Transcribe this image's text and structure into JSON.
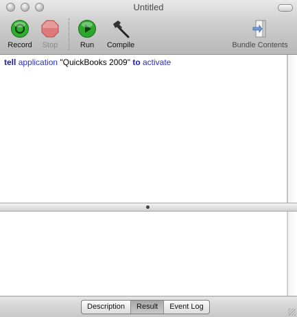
{
  "window": {
    "title": "Untitled"
  },
  "toolbar": {
    "record_label": "Record",
    "stop_label": "Stop",
    "run_label": "Run",
    "compile_label": "Compile",
    "bundle_contents_label": "Bundle Contents",
    "colors": {
      "record_green": "#2fae2f",
      "stop_red": "#e07a7a",
      "run_green": "#2ba82b"
    },
    "icons": {
      "record": "record-circle-icon",
      "stop": "stop-octagon-icon",
      "run": "play-icon",
      "compile": "hammer-icon",
      "bundle": "bundle-drawer-icon"
    }
  },
  "editor": {
    "tokens": [
      {
        "text": "tell",
        "type": "keyword"
      },
      {
        "text": " ",
        "type": "space"
      },
      {
        "text": "application",
        "type": "identifier"
      },
      {
        "text": " ",
        "type": "space"
      },
      {
        "text": "\"QuickBooks 2009\"",
        "type": "string"
      },
      {
        "text": " ",
        "type": "space"
      },
      {
        "text": "to",
        "type": "keyword"
      },
      {
        "text": " ",
        "type": "space"
      },
      {
        "text": "activate",
        "type": "identifier"
      }
    ]
  },
  "result": {
    "text": ""
  },
  "bottom_tabs": {
    "description_label": "Description",
    "result_label": "Result",
    "event_log_label": "Event Log",
    "selected": "Result"
  }
}
